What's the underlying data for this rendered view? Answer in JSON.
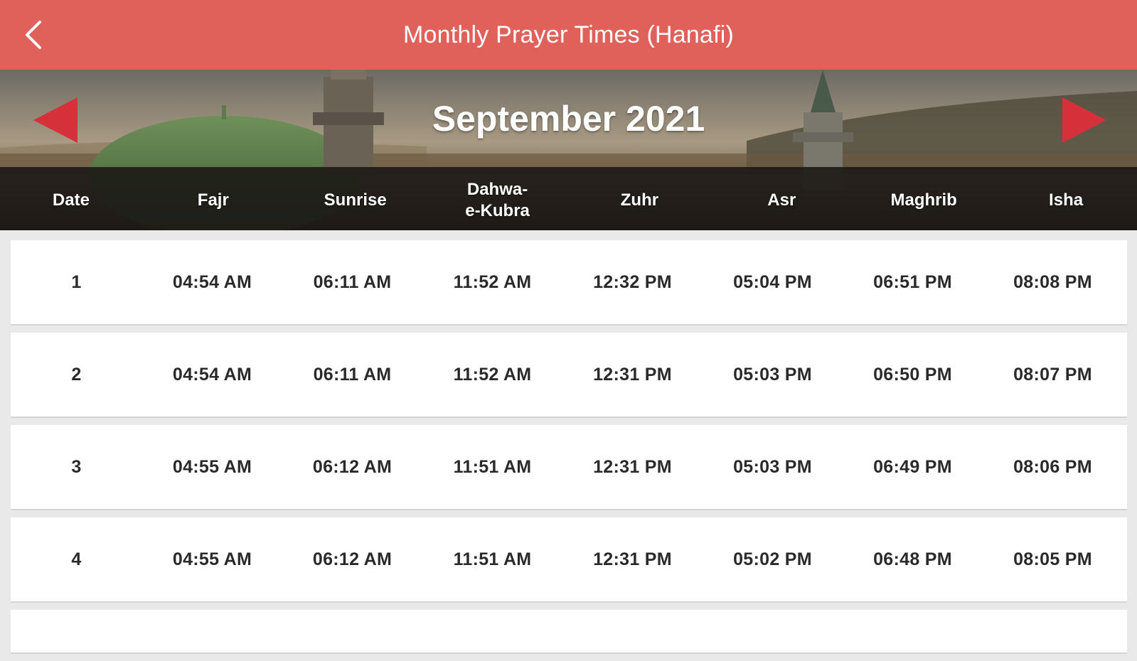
{
  "header": {
    "title": "Monthly Prayer Times (Hanafi)",
    "back_icon": "chevron-left-icon"
  },
  "month_nav": {
    "label": "September 2021",
    "prev_icon": "triangle-left-icon",
    "next_icon": "triangle-right-icon",
    "arrow_color": "#d6303a"
  },
  "columns": [
    "Date",
    "Fajr",
    "Sunrise",
    "Dahwa-\ne-Kubra",
    "Zuhr",
    "Asr",
    "Maghrib",
    "Isha"
  ],
  "rows": [
    {
      "date": "1",
      "fajr": "04:54 AM",
      "sunrise": "06:11 AM",
      "dahwa": "11:52 AM",
      "zuhr": "12:32 PM",
      "asr": "05:04 PM",
      "maghrib": "06:51 PM",
      "isha": "08:08 PM"
    },
    {
      "date": "2",
      "fajr": "04:54 AM",
      "sunrise": "06:11 AM",
      "dahwa": "11:52 AM",
      "zuhr": "12:31 PM",
      "asr": "05:03 PM",
      "maghrib": "06:50 PM",
      "isha": "08:07 PM"
    },
    {
      "date": "3",
      "fajr": "04:55 AM",
      "sunrise": "06:12 AM",
      "dahwa": "11:51 AM",
      "zuhr": "12:31 PM",
      "asr": "05:03 PM",
      "maghrib": "06:49 PM",
      "isha": "08:06 PM"
    },
    {
      "date": "4",
      "fajr": "04:55 AM",
      "sunrise": "06:12 AM",
      "dahwa": "11:51 AM",
      "zuhr": "12:31 PM",
      "asr": "05:02 PM",
      "maghrib": "06:48 PM",
      "isha": "08:05 PM"
    }
  ],
  "colors": {
    "header_bar": "#e0605a",
    "row_bg": "#ffffff",
    "page_bg": "#e9e9e9"
  }
}
